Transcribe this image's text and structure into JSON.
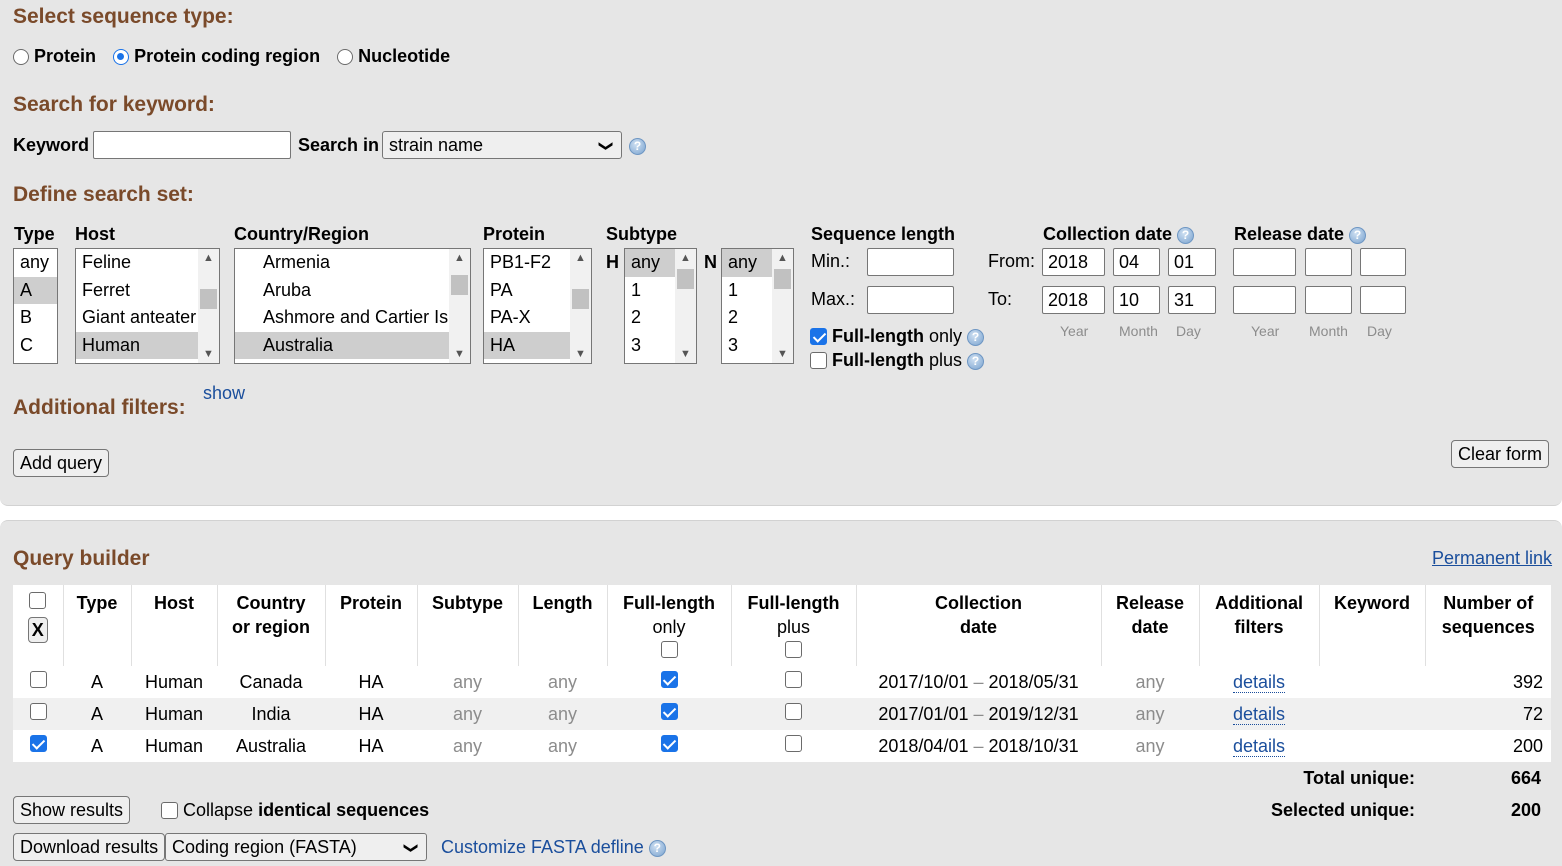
{
  "sequence_type": {
    "title": "Select sequence type:",
    "options": [
      "Protein",
      "Protein coding region",
      "Nucleotide"
    ],
    "selected": "Protein coding region"
  },
  "keyword_search": {
    "title": "Search for keyword:",
    "keyword_label": "Keyword",
    "keyword_value": "",
    "search_in_label": "Search in",
    "search_in_value": "strain name"
  },
  "search_set": {
    "title": "Define search set:",
    "type": {
      "label": "Type",
      "options": [
        "any",
        "A",
        "B",
        "C"
      ],
      "selected": "A"
    },
    "host": {
      "label": "Host",
      "options": [
        "Feline",
        "Ferret",
        "Giant anteater",
        "Human"
      ],
      "selected": "Human"
    },
    "country": {
      "label": "Country/Region",
      "options": [
        "Armenia",
        "Aruba",
        "Ashmore and Cartier Is",
        "Australia"
      ],
      "selected": "Australia"
    },
    "protein": {
      "label": "Protein",
      "options": [
        "PB1-F2",
        "PA",
        "PA-X",
        "HA"
      ],
      "selected": "HA"
    },
    "subtype": {
      "label": "Subtype",
      "h_label": "H",
      "n_label": "N",
      "h_options": [
        "any",
        "1",
        "2",
        "3"
      ],
      "n_options": [
        "any",
        "1",
        "2",
        "3"
      ],
      "h_selected": "any",
      "n_selected": "any"
    },
    "sequence_length": {
      "label": "Sequence length",
      "min_label": "Min.:",
      "max_label": "Max.:",
      "min_value": "",
      "max_value": "",
      "full_length_only_bold": "Full-length",
      "full_length_only_rest": " only",
      "full_length_only_checked": true,
      "full_length_plus_bold": "Full-length",
      "full_length_plus_rest": " plus",
      "full_length_plus_checked": false
    },
    "collection_date": {
      "label": "Collection date",
      "from_label": "From:",
      "to_label": "To:",
      "from": {
        "year": "2018",
        "month": "04",
        "day": "01"
      },
      "to": {
        "year": "2018",
        "month": "10",
        "day": "31"
      }
    },
    "release_date": {
      "label": "Release date",
      "from": {
        "year": "",
        "month": "",
        "day": ""
      },
      "to": {
        "year": "",
        "month": "",
        "day": ""
      }
    },
    "date_hints": {
      "year": "Year",
      "month": "Month",
      "day": "Day"
    }
  },
  "additional_filters": {
    "title": "Additional filters:",
    "show_link": "show"
  },
  "buttons": {
    "add_query": "Add query",
    "clear_form": "Clear form"
  },
  "query_builder": {
    "title": "Query builder",
    "permanent_link": "Permanent link",
    "remove_button": "X",
    "headers": {
      "type": "Type",
      "host": "Host",
      "country_1": "Country",
      "country_2": "or region",
      "protein": "Protein",
      "subtype": "Subtype",
      "length": "Length",
      "flo_1": "Full-length",
      "flo_2": "only",
      "flp_1": "Full-length",
      "flp_2": "plus",
      "coll_1": "Collection",
      "coll_2": "date",
      "rel_1": "Release",
      "rel_2": "date",
      "add_1": "Additional",
      "add_2": "filters",
      "keyword": "Keyword",
      "num_1": "Number of",
      "num_2": "sequences"
    },
    "rows": [
      {
        "selected": false,
        "type": "A",
        "host": "Human",
        "country": "Canada",
        "protein": "HA",
        "subtype": "any",
        "length": "any",
        "full_length_only": true,
        "full_length_plus": false,
        "coll_from": "2017/10/01",
        "coll_sep": "–",
        "coll_to": "2018/05/31",
        "release": "any",
        "filters": "details",
        "keyword": "",
        "count": "392"
      },
      {
        "selected": false,
        "type": "A",
        "host": "Human",
        "country": "India",
        "protein": "HA",
        "subtype": "any",
        "length": "any",
        "full_length_only": true,
        "full_length_plus": false,
        "coll_from": "2017/01/01",
        "coll_sep": "–",
        "coll_to": "2019/12/31",
        "release": "any",
        "filters": "details",
        "keyword": "",
        "count": "72"
      },
      {
        "selected": true,
        "type": "A",
        "host": "Human",
        "country": "Australia",
        "protein": "HA",
        "subtype": "any",
        "length": "any",
        "full_length_only": true,
        "full_length_plus": false,
        "coll_from": "2018/04/01",
        "coll_sep": "–",
        "coll_to": "2018/10/31",
        "release": "any",
        "filters": "details",
        "keyword": "",
        "count": "200"
      }
    ],
    "total_label": "Total unique:",
    "total_value": "664",
    "selected_label": "Selected unique:",
    "selected_value": "200"
  },
  "results": {
    "show_results": "Show results",
    "collapse_prefix": "Collapse ",
    "collapse_bold": "identical sequences",
    "download_results": "Download results",
    "format_value": "Coding region (FASTA)",
    "customize_link": "Customize FASTA defline"
  },
  "colors": {
    "section_title": "#7a4a2a",
    "link": "#1a4e9c",
    "panel_bg": "#e6e6e6",
    "accent": "#1a73e8"
  }
}
